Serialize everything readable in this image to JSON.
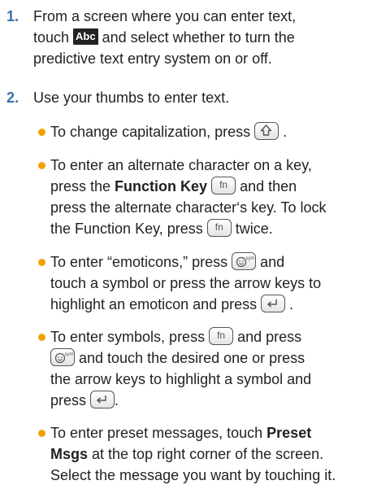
{
  "steps": [
    {
      "number": "1.",
      "lines": [
        {
          "before": "From a screen where you can enter text,"
        },
        {
          "before": "touch ",
          "icon_label": "Abc",
          "after": " and select whether to turn the"
        },
        {
          "before": "predictive text entry system on or off."
        }
      ]
    },
    {
      "number": "2.",
      "lines": [
        {
          "before": "Use your thumbs to enter text."
        }
      ]
    }
  ],
  "bullets": [
    {
      "lines": [
        {
          "before": "To change capitalization, press ",
          "icon": "shift-key-icon",
          "after": " ."
        }
      ]
    },
    {
      "lines": [
        {
          "before": "To enter an alternate character on a key,"
        },
        {
          "before": "press the ",
          "bold": "Function Key",
          "icon": "fn-key-icon",
          "icon_label": "fn",
          "after": " and then"
        },
        {
          "before": "press the alternate character‘s key. To lock"
        },
        {
          "before": "the Function Key, press ",
          "icon": "fn-key-icon",
          "icon_label": "fn",
          "after": " twice."
        }
      ]
    },
    {
      "lines": [
        {
          "before": "To enter “emoticons,” press ",
          "icon": "emoticon-sym-key-icon",
          "icon_label": "sym",
          "after": " and"
        },
        {
          "before": "touch a symbol or press the arrow keys to"
        },
        {
          "before": "highlight an emoticon and press ",
          "icon": "enter-key-icon",
          "after": " ."
        }
      ]
    },
    {
      "lines": [
        {
          "before": "To enter symbols, press ",
          "icon": "fn-key-icon",
          "icon_label": "fn",
          "after": " and press"
        },
        {
          "before": "",
          "icon": "emoticon-sym-key-icon",
          "icon_label": "sym",
          "after": " and touch the desired one or press"
        },
        {
          "before": "the arrow keys to highlight a symbol and"
        },
        {
          "before": "press ",
          "icon": "enter-key-icon",
          "after": "."
        }
      ]
    },
    {
      "lines": [
        {
          "before": "To enter preset messages, touch ",
          "bold": "Preset"
        },
        {
          "bold_start": "Msgs",
          "before": " at the top right corner of the screen."
        },
        {
          "before": "Select the message you want by touching it."
        }
      ]
    }
  ],
  "colors": {
    "step_number": "#3d6ea8",
    "bullet": "#f3a200",
    "text": "#231f20"
  }
}
